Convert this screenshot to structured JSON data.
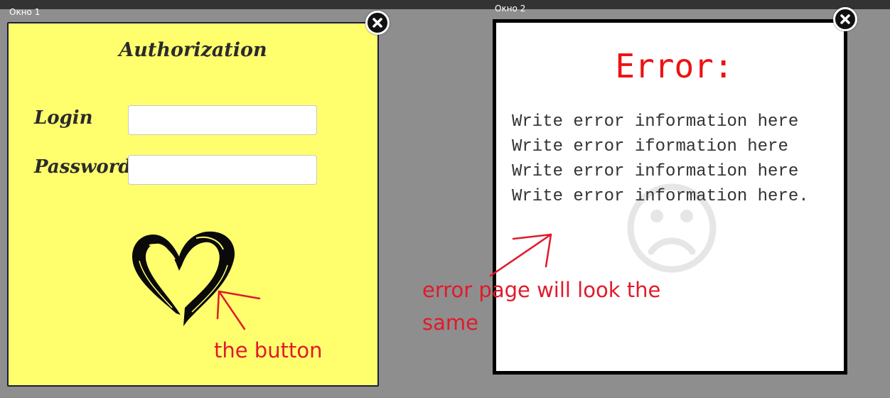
{
  "window1": {
    "label": "Окно 1",
    "title": "Authorization",
    "login_label": "Login",
    "login_value": "",
    "password_label": "Password",
    "password_value": ""
  },
  "window2": {
    "label": "Окно 2",
    "error_title": "Error:",
    "error_lines": [
      "Write error information here",
      "Write error iformation here",
      "Write error information here",
      "Write error information here."
    ]
  },
  "annotations": {
    "button_note": "the button",
    "error_note_line1": "error page will look the",
    "error_note_line2": "same"
  },
  "colors": {
    "auth_background": "#ffff6e",
    "error_text": "#ee1111",
    "annotation": "#e11a2a",
    "desktop": "#8e8e8e"
  },
  "icons": {
    "close": "close-circle-icon",
    "heart": "heart-icon",
    "sad": "sad-face-icon"
  }
}
